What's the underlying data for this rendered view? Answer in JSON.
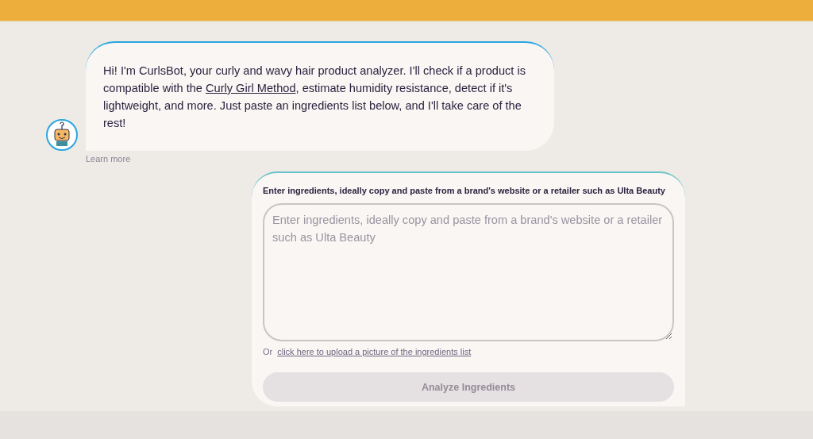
{
  "bot_message": {
    "text_before": "Hi! I'm CurlsBot, your curly and wavy hair product analyzer. I'll check if a product is compatible with the ",
    "link": "Curly Girl Method",
    "text_after": ", estimate humidity resistance, detect if it's lightweight, and more. Just paste an ingredients list below, and I'll take care of the rest!",
    "learn_more": "Learn more"
  },
  "input_card": {
    "label": "Enter ingredients, ideally copy and paste from a brand's website or a retailer such as Ulta Beauty",
    "placeholder": "Enter ingredients, ideally copy and paste from a brand's website or a retailer such as Ulta Beauty",
    "or_text": "Or",
    "upload_link": "click here to upload a picture of the ingredients list"
  },
  "analyze_button": {
    "label": "Analyze Ingredients",
    "disabled": true
  }
}
